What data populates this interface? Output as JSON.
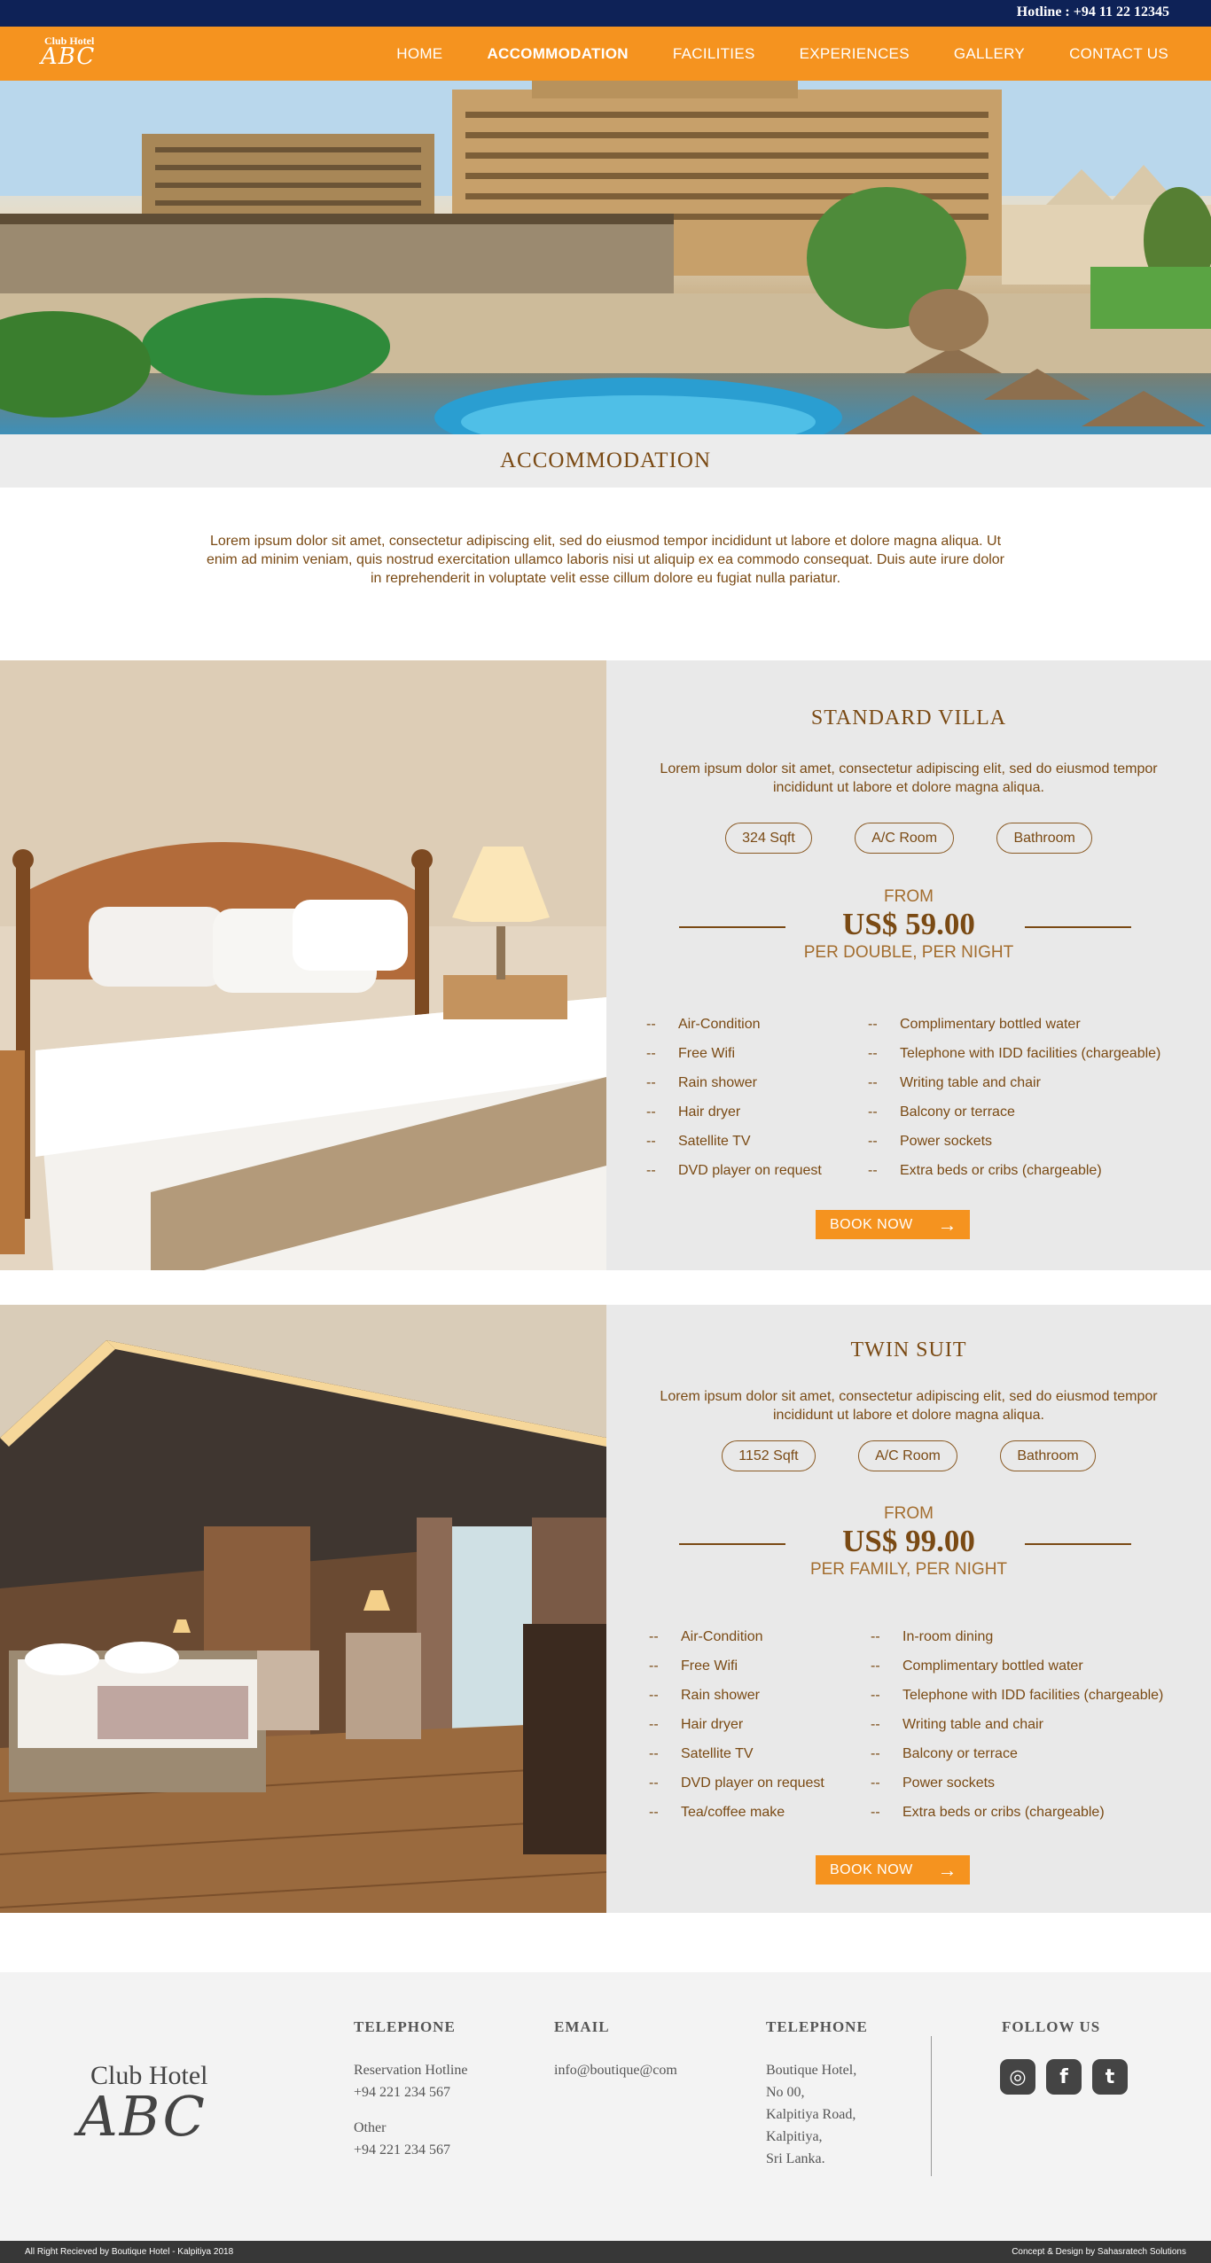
{
  "topbar": {
    "hotline": "Hotline : +94 11 22 12345"
  },
  "nav": {
    "logo_small": "Club Hotel",
    "logo_big": "ABC",
    "items": [
      {
        "label": "HOME"
      },
      {
        "label": "ACCOMMODATION"
      },
      {
        "label": "FACILITIES"
      },
      {
        "label": "EXPERIENCES"
      },
      {
        "label": "GALLERY"
      },
      {
        "label": "CONTACT US"
      }
    ]
  },
  "page": {
    "title": "ACCOMMODATION",
    "intro": "Lorem ipsum dolor sit amet, consectetur adipiscing elit, sed do eiusmod tempor incididunt ut labore et dolore magna aliqua. Ut enim ad minim veniam, quis nostrud exercitation ullamco laboris nisi ut aliquip ex ea commodo consequat. Duis aute irure dolor in reprehenderit in voluptate velit esse cillum dolore eu fugiat nulla pariatur."
  },
  "rooms": [
    {
      "name": "STANDARD VILLA",
      "desc": "Lorem ipsum dolor sit amet, consectetur adipiscing elit, sed do eiusmod tempor incididunt ut labore et dolore magna aliqua.",
      "features": [
        "324 Sqft",
        "A/C Room",
        "Bathroom"
      ],
      "from": "FROM",
      "price": "US$ 59.00",
      "per": "PER DOUBLE, PER NIGHT",
      "amenities_left": [
        "Air-Condition",
        "Free Wifi",
        "Rain shower",
        "Hair dryer",
        "Satellite TV",
        "DVD player on request"
      ],
      "amenities_right": [
        "Complimentary bottled water",
        "Telephone with IDD facilities (chargeable)",
        "Writing table and chair",
        "Balcony or terrace",
        "Power sockets",
        "Extra beds or cribs (chargeable)"
      ],
      "book": "BOOK NOW"
    },
    {
      "name": "TWIN SUIT",
      "desc": "Lorem ipsum dolor sit amet, consectetur adipiscing elit, sed do eiusmod tempor incididunt ut labore et dolore magna aliqua.",
      "features": [
        "1152 Sqft",
        "A/C Room",
        "Bathroom"
      ],
      "from": "FROM",
      "price": "US$ 99.00",
      "per": "PER FAMILY, PER NIGHT",
      "amenities_left": [
        "Air-Condition",
        "Free Wifi",
        "Rain shower",
        "Hair dryer",
        "Satellite TV",
        "DVD player on request",
        "Tea/coffee make"
      ],
      "amenities_right": [
        "In-room dining",
        "Complimentary bottled water",
        "Telephone with IDD facilities (chargeable)",
        "Writing table and chair",
        "Balcony or terrace",
        "Power sockets",
        "Extra beds or cribs (chargeable)"
      ],
      "book": "BOOK NOW"
    }
  ],
  "dash": "--",
  "footer": {
    "logo_small": "Club Hotel",
    "logo_big": "ABC",
    "tel_heading": "TELEPHONE",
    "tel_label1": "Reservation Hotline",
    "tel_value1": "+94 221 234 567",
    "tel_label2": "Other",
    "tel_value2": "+94 221 234 567",
    "email_heading": "EMAIL",
    "email": "info@boutique@com",
    "addr_heading": "TELEPHONE",
    "addr": [
      "Boutique Hotel,",
      "No 00,",
      "Kalpitiya Road,",
      "Kalpitiya,",
      "Sri Lanka."
    ],
    "follow_heading": "FOLLOW US",
    "socials": [
      {
        "icon": "instagram-icon",
        "glyph": "◎"
      },
      {
        "icon": "facebook-icon",
        "glyph": "f"
      },
      {
        "icon": "twitter-icon",
        "glyph": "t"
      }
    ]
  },
  "bottombar": {
    "left": "All Right Recieved by Boutique Hotel - Kalpitiya 2018",
    "right": "Concept & Design by Sahasratech Solutions"
  },
  "colors": {
    "navy": "#0e2257",
    "orange": "#f5931f",
    "brown": "#7a4a14",
    "panel": "#e9e9e9",
    "footer": "#f3f3f3",
    "bottombar": "#373737"
  }
}
